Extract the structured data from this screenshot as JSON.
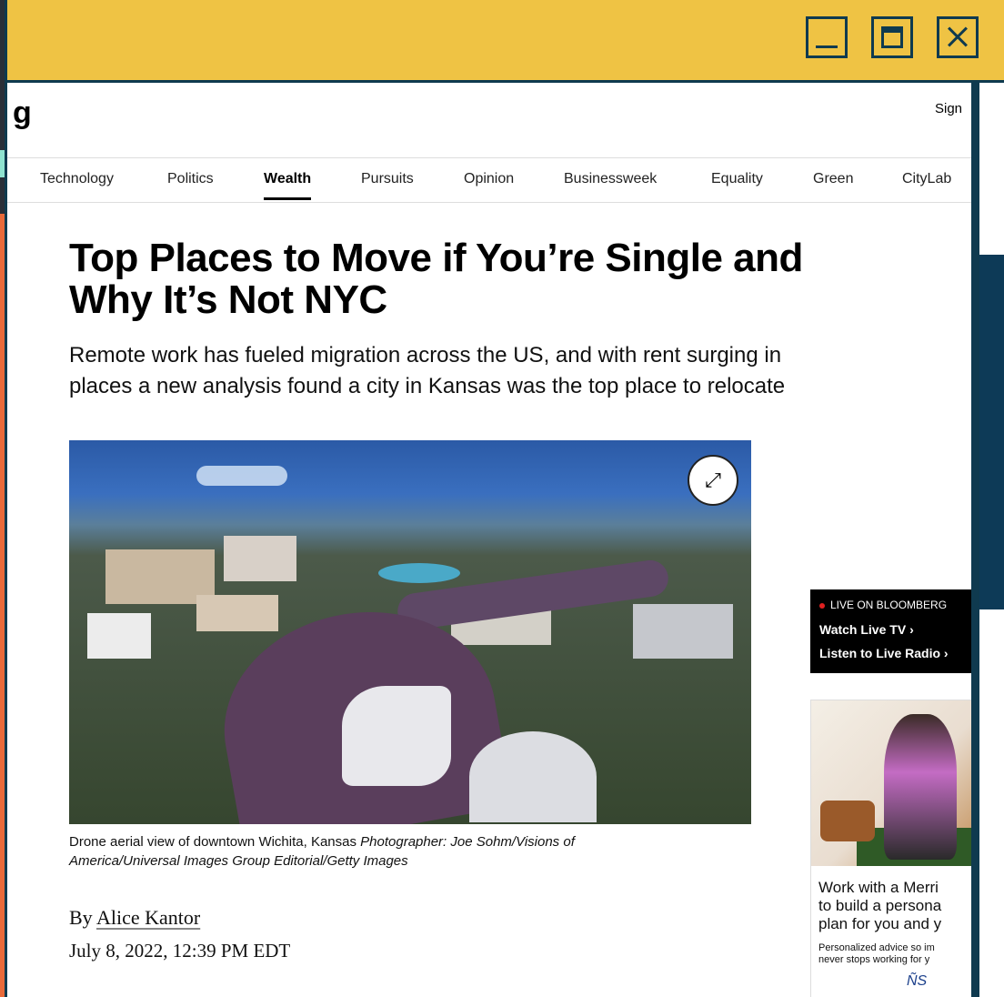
{
  "window": {
    "controls": [
      "minimize",
      "maximize",
      "close"
    ]
  },
  "site": {
    "logo_fragment": "g",
    "signin_fragment": "Sign"
  },
  "nav": {
    "items": [
      {
        "label": "Technology",
        "active": false
      },
      {
        "label": "Politics",
        "active": false
      },
      {
        "label": "Wealth",
        "active": true
      },
      {
        "label": "Pursuits",
        "active": false
      },
      {
        "label": "Opinion",
        "active": false
      },
      {
        "label": "Businessweek",
        "active": false
      },
      {
        "label": "Equality",
        "active": false
      },
      {
        "label": "Green",
        "active": false
      },
      {
        "label": "CityLab",
        "active": false
      }
    ]
  },
  "article": {
    "headline_line1": "Top Places to Move if You’re Single and",
    "headline_line2": "Why It’s Not NYC",
    "dek_line1": "Remote work has fueled migration across the US, and with rent surging in",
    "dek_line2": "places a new analysis found a city in Kansas was the top place to relocate",
    "caption_text": "Drone aerial view of downtown Wichita, Kansas",
    "caption_credit_line1": "Photographer: Joe Sohm/Visions of",
    "caption_credit_line2": "America/Universal Images Group Editorial/Getty Images",
    "byline_prefix": "By",
    "author": "Alice Kantor",
    "date": "July 8, 2022, 12:39 PM EDT"
  },
  "live": {
    "tag": "LIVE ON BLOOMBERG",
    "tv": "Watch Live TV",
    "radio": "Listen to Live Radio"
  },
  "ad": {
    "headline_lines": [
      "Work with a Merri",
      "to build a persona",
      "plan for you and y"
    ],
    "sub_lines": [
      "Personalized advice so im",
      "never stops working for y"
    ],
    "logo": "ÑS"
  },
  "colors": {
    "titlebar": "#efc344",
    "frame": "#0f3a4f",
    "background_accent": "#e86a3a"
  }
}
